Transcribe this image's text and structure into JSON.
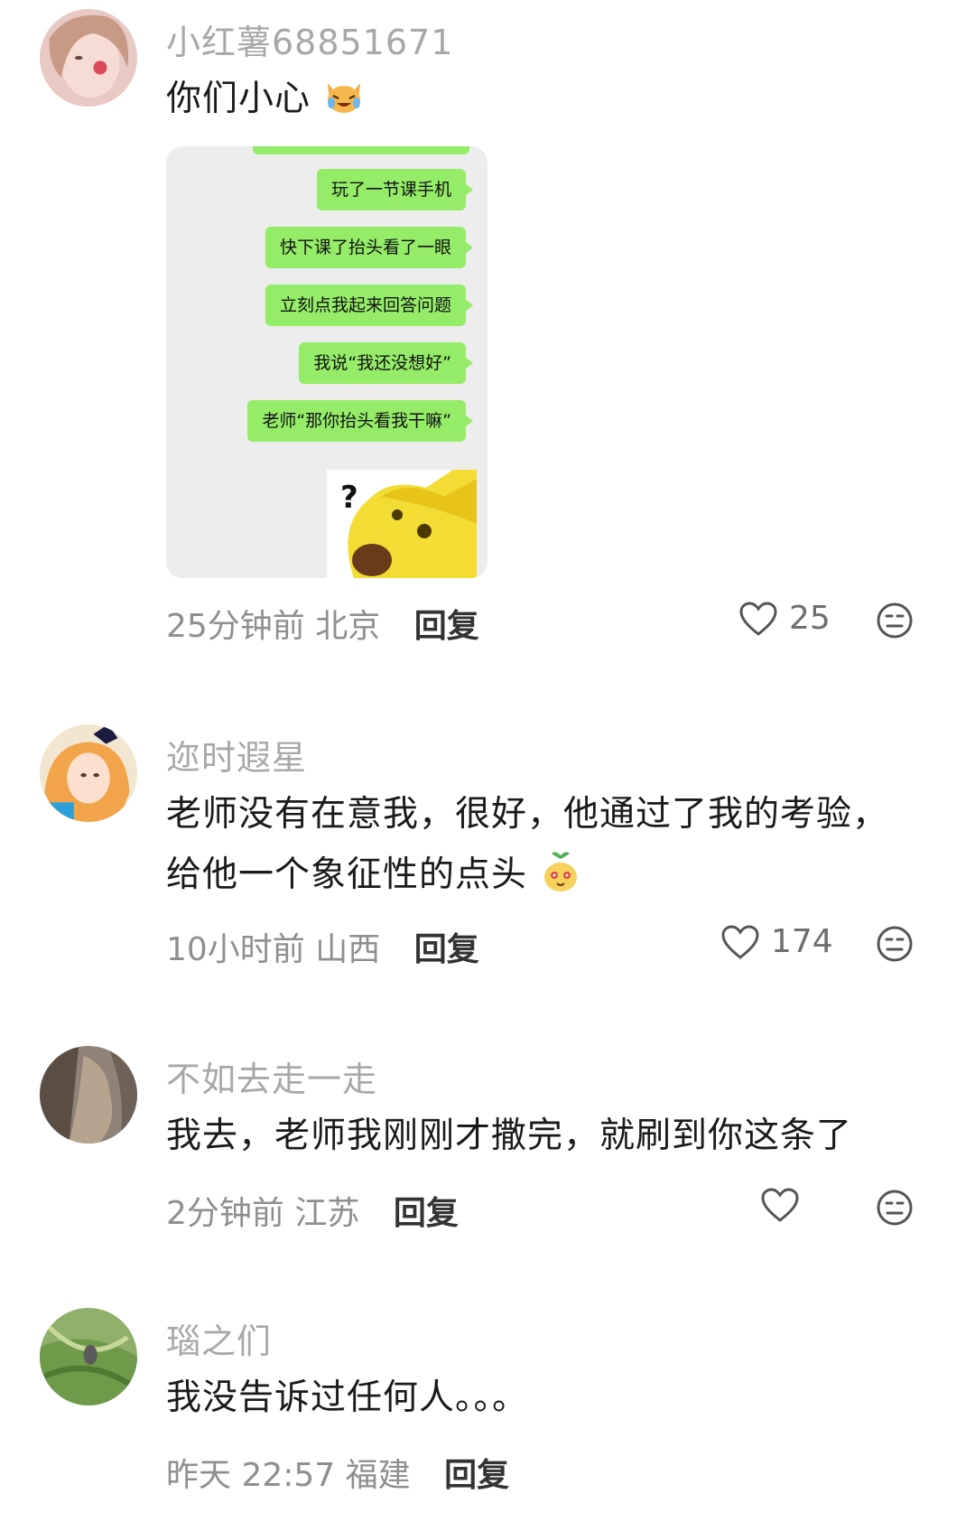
{
  "comments": [
    {
      "username": "小红薯68851671",
      "text": "你们小心",
      "emoji": "crying-laughing-cat-emoji",
      "time": "25分钟前",
      "location": "北京",
      "reply_label": "回复",
      "likes": "25",
      "chat_image": {
        "messages": [
          "玩了一节课手机",
          "快下课了抬头看了一眼",
          "立刻点我起来回答问题",
          "我说“我还没想好”",
          "老师“那你抬头看我干嘛”"
        ],
        "sticker_text": "?"
      }
    },
    {
      "username": "迩时遐星",
      "text_line1": "老师没有在意我，很好，他通过了我的考验，",
      "text_line2": "给他一个象征性的点头",
      "emoji": "nodding-sprout-emoji",
      "time": "10小时前",
      "location": "山西",
      "reply_label": "回复",
      "likes": "174"
    },
    {
      "username": "不如去走一走",
      "text": "我去，老师我刚刚才撒完，就刷到你这条了",
      "time": "2分钟前",
      "location": "江苏",
      "reply_label": "回复",
      "likes": ""
    },
    {
      "username": "瑙之们",
      "text": "我没告诉过任何人。。。",
      "time": "昨天 22:57",
      "location": "福建",
      "reply_label": "回复"
    }
  ],
  "colors": {
    "username": "#a8a8a8",
    "body_text": "#1a1a1a",
    "meta_text": "#8f8f8f",
    "chat_bubble": "#95ec69",
    "chat_background": "#ededed"
  },
  "icons": {
    "like": "heart-outline-icon",
    "sentiment": "neutral-face-icon"
  }
}
